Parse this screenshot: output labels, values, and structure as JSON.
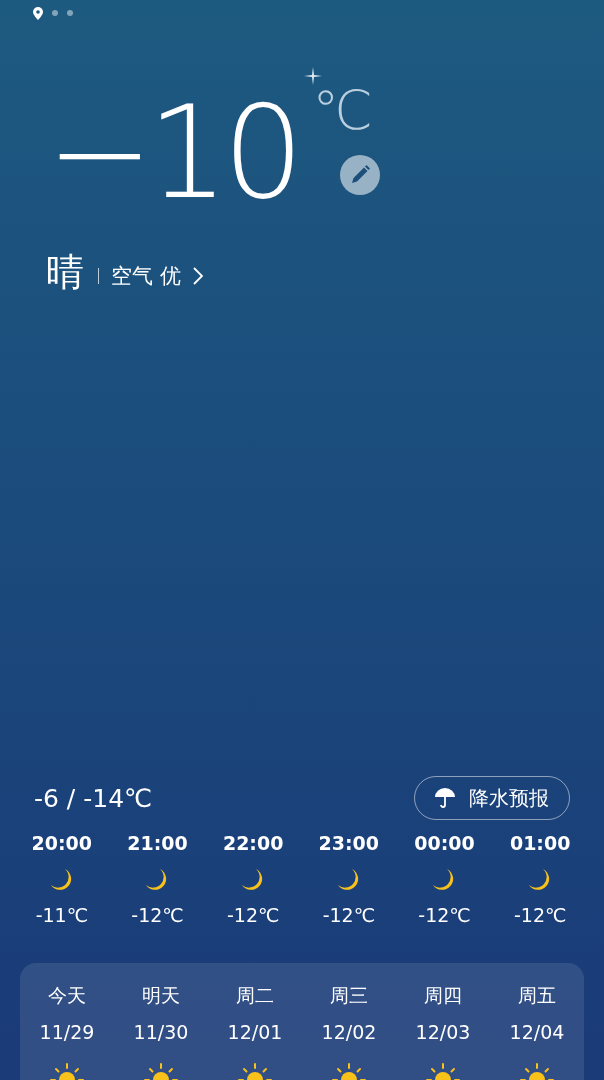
{
  "pages": [
    {
      "kind": "location",
      "selected": true
    },
    {
      "kind": "dot",
      "selected": false
    },
    {
      "kind": "dot",
      "selected": false
    }
  ],
  "current": {
    "temperature": "−10",
    "unit": "℃",
    "condition": "晴",
    "air_quality": "空气 优"
  },
  "range": "-6 / -14℃",
  "precipitation_button": {
    "label": "降水预报"
  },
  "hourly": [
    {
      "time": "20:00",
      "kind": "moon",
      "temp": "-11℃"
    },
    {
      "time": "21:00",
      "kind": "moon",
      "temp": "-12℃"
    },
    {
      "time": "22:00",
      "kind": "moon",
      "temp": "-12℃"
    },
    {
      "time": "23:00",
      "kind": "moon",
      "temp": "-12℃"
    },
    {
      "time": "00:00",
      "kind": "moon",
      "temp": "-12℃"
    },
    {
      "time": "01:00",
      "kind": "moon",
      "temp": "-12℃"
    }
  ],
  "daily": [
    {
      "day": "今天",
      "date": "11/29",
      "kind": "sun"
    },
    {
      "day": "明天",
      "date": "11/30",
      "kind": "sun"
    },
    {
      "day": "周二",
      "date": "12/01",
      "kind": "sun"
    },
    {
      "day": "周三",
      "date": "12/02",
      "kind": "sun"
    },
    {
      "day": "周四",
      "date": "12/03",
      "kind": "sun"
    },
    {
      "day": "周五",
      "date": "12/04",
      "kind": "sun"
    }
  ]
}
